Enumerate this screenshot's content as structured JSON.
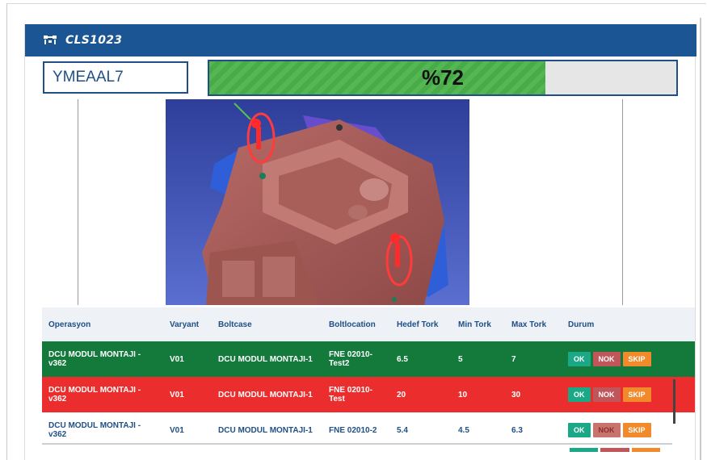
{
  "header": {
    "title": "CLS1023",
    "icon": "device-icon"
  },
  "serial": {
    "value": "YMEAAL7"
  },
  "progress": {
    "label": "%72",
    "fraction": 0.72
  },
  "table": {
    "columns": [
      "Operasyon",
      "Varyant",
      "Boltcase",
      "Boltlocation",
      "Hedef Tork",
      "Min Tork",
      "Max Tork",
      "Durum"
    ],
    "rows": [
      {
        "status": "ok",
        "operasyon": "DCU MODUL MONTAJI - v362",
        "varyant": "V01",
        "boltcase": "DCU MODUL MONTAJI-1",
        "boltlocation": "FNE 02010-Test2",
        "hedef": "6.5",
        "min": "5",
        "max": "7"
      },
      {
        "status": "nok",
        "operasyon": "DCU MODUL MONTAJI - v362",
        "varyant": "V01",
        "boltcase": "DCU MODUL MONTAJI-1",
        "boltlocation": "FNE 02010-Test",
        "hedef": "20",
        "min": "10",
        "max": "30"
      },
      {
        "status": "pending",
        "operasyon": "DCU MODUL MONTAJI - v362",
        "varyant": "V01",
        "boltcase": "DCU MODUL MONTAJI-1",
        "boltlocation": "FNE 02010-2",
        "hedef": "5.4",
        "min": "4.5",
        "max": "6.3"
      }
    ],
    "buttons": {
      "ok": "OK",
      "nok": "NOK",
      "skip": "SKIP"
    }
  },
  "colors": {
    "header": "#1b5594",
    "ok_row": "#147a3c",
    "nok_row": "#ec2d2d",
    "progress_fill": "#53b752"
  }
}
